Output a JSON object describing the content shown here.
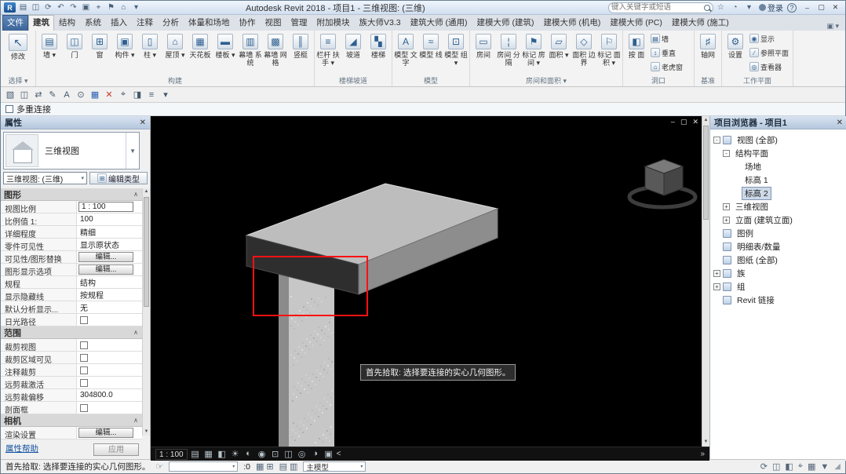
{
  "titlebar": {
    "title": "Autodesk Revit 2018 -  项目1 - 三维视图: (三维)",
    "logo_letter": "R",
    "search": {
      "placeholder": "键入关键字或短语"
    },
    "signin_label": "登录",
    "help_glyph": "?",
    "qat_icons": [
      {
        "name": "open-icon",
        "glyph": "▤"
      },
      {
        "name": "save-icon",
        "glyph": "◫"
      },
      {
        "name": "sync-icon",
        "glyph": "⟳"
      },
      {
        "name": "undo-icon",
        "glyph": "↶"
      },
      {
        "name": "redo-icon",
        "glyph": "↷"
      },
      {
        "name": "print-icon",
        "glyph": "▣"
      },
      {
        "name": "measure-icon",
        "glyph": "⌖"
      },
      {
        "name": "tag-icon",
        "glyph": "⚑"
      },
      {
        "name": "default-3d-view-icon",
        "glyph": "⌂"
      },
      {
        "name": "customize-qat-icon",
        "glyph": "▾"
      }
    ],
    "info_icons": [
      {
        "name": "exchange-apps-icon",
        "glyph": "☆"
      },
      {
        "name": "notification-icon",
        "glyph": "◔"
      },
      {
        "name": "help-menu-icon",
        "glyph": "▾"
      }
    ],
    "window_buttons": [
      {
        "name": "minimize-button",
        "glyph": "–"
      },
      {
        "name": "maximize-button",
        "glyph": "▢"
      },
      {
        "name": "close-button",
        "glyph": "✕"
      }
    ]
  },
  "tabs": {
    "active_index": 1,
    "items": [
      "文件",
      "建筑",
      "结构",
      "系统",
      "插入",
      "注释",
      "分析",
      "体量和场地",
      "协作",
      "视图",
      "管理",
      "附加模块",
      "族大师V3.3",
      "建筑大师 (通用)",
      "建模大师 (建筑)",
      "建模大师 (机电)",
      "建模大师 (PC)",
      "建模大师 (施工)"
    ],
    "ribbon_toggle_glyph": "▣ ▾"
  },
  "ribbon": {
    "panels": [
      {
        "name": "select",
        "label": "选择 ▾",
        "tools": [
          {
            "type": "big",
            "wide": true,
            "name": "modify",
            "label": "修改",
            "glyph": "↖"
          }
        ]
      },
      {
        "name": "build",
        "label": "构建",
        "tools": [
          {
            "type": "big",
            "name": "wall",
            "label": "墙",
            "glyph": "▤",
            "arrow": true
          },
          {
            "type": "big",
            "name": "door",
            "label": "门",
            "glyph": "◫"
          },
          {
            "type": "big",
            "name": "window",
            "label": "窗",
            "glyph": "⊞"
          },
          {
            "type": "big",
            "name": "component",
            "label": "构件",
            "glyph": "▣",
            "arrow": true
          },
          {
            "type": "big",
            "name": "column",
            "label": "柱",
            "glyph": "▯",
            "arrow": true
          },
          {
            "type": "big",
            "name": "roof",
            "label": "屋顶",
            "glyph": "⌂",
            "arrow": true
          },
          {
            "type": "big",
            "name": "ceiling",
            "label": "天花板",
            "glyph": "▦"
          },
          {
            "type": "big",
            "name": "floor",
            "label": "楼板",
            "glyph": "▬",
            "arrow": true
          },
          {
            "type": "big",
            "name": "curtain-system",
            "label": "幕墙 系统",
            "glyph": "▥"
          },
          {
            "type": "big",
            "name": "curtain-grid",
            "label": "幕墙 网格",
            "glyph": "▩"
          },
          {
            "type": "big",
            "name": "mullion",
            "label": "竖梃",
            "glyph": "║"
          }
        ]
      },
      {
        "name": "circulation",
        "label": "楼梯坡道",
        "tools": [
          {
            "type": "big",
            "name": "railing",
            "label": "栏杆 扶手",
            "glyph": "≡",
            "arrow": true
          },
          {
            "type": "big",
            "name": "ramp",
            "label": "坡道",
            "glyph": "◢"
          },
          {
            "type": "big",
            "name": "stair",
            "label": "楼梯",
            "glyph": "▚"
          }
        ]
      },
      {
        "name": "model",
        "label": "模型",
        "tools": [
          {
            "type": "big",
            "name": "model-text",
            "label": "模型 文字",
            "glyph": "A"
          },
          {
            "type": "big",
            "name": "model-line",
            "label": "模型 线",
            "glyph": "≈"
          },
          {
            "type": "big",
            "name": "model-group",
            "label": "模型 组",
            "glyph": "⊡",
            "arrow": true
          }
        ]
      },
      {
        "name": "room-area",
        "label": "房间和面积 ▾",
        "tools": [
          {
            "type": "big",
            "name": "room",
            "label": "房间",
            "glyph": "▭"
          },
          {
            "type": "big",
            "name": "room-separator",
            "label": "房间 分隔",
            "glyph": "¦"
          },
          {
            "type": "big",
            "name": "tag-room",
            "label": "标记 房间",
            "glyph": "⚑",
            "arrow": true
          },
          {
            "type": "big",
            "name": "area",
            "label": "面积",
            "glyph": "▱",
            "arrow": true
          },
          {
            "type": "big",
            "name": "area-boundary",
            "label": "面积 边界",
            "glyph": "◇"
          },
          {
            "type": "big",
            "name": "tag-area",
            "label": "标记 面积",
            "glyph": "⚐",
            "arrow": true
          }
        ]
      },
      {
        "name": "opening",
        "label": "洞口",
        "tools": [
          {
            "type": "big",
            "name": "opening-by-face",
            "label": "按 面",
            "glyph": "◧"
          },
          {
            "type": "stack",
            "items": [
              {
                "name": "wall-opening",
                "label": "墙",
                "glyph": "▤"
              },
              {
                "name": "vertical-opening",
                "label": "垂直",
                "glyph": "↕"
              },
              {
                "name": "dormer-opening",
                "label": "老虎窗",
                "glyph": "⌂"
              }
            ]
          }
        ]
      },
      {
        "name": "datum",
        "label": "基准",
        "tools": [
          {
            "type": "big",
            "name": "grid",
            "label": "轴网",
            "glyph": "♯"
          }
        ]
      },
      {
        "name": "work-plane",
        "label": "工作平面",
        "tools": [
          {
            "type": "big",
            "name": "set-work-plane",
            "label": "设置",
            "glyph": "⚙"
          },
          {
            "type": "stack",
            "items": [
              {
                "name": "show-work-plane",
                "label": "显示",
                "glyph": "◉"
              },
              {
                "name": "ref-plane",
                "label": "参照平面",
                "glyph": "∕"
              },
              {
                "name": "work-plane-viewer",
                "label": "查看器",
                "glyph": "◎"
              }
            ]
          }
        ]
      }
    ]
  },
  "toolbar2": {
    "icons": [
      {
        "name": "sheet-icon",
        "glyph": "▧",
        "color": "#45586b"
      },
      {
        "name": "save-small-icon",
        "glyph": "◫",
        "color": "#45586b"
      },
      {
        "name": "swap-icon",
        "glyph": "⇄",
        "color": "#45586b"
      },
      {
        "name": "pencil-icon",
        "glyph": "✎",
        "color": "#45586b"
      },
      {
        "name": "text-tool-icon",
        "glyph": "A",
        "color": "#45586b"
      },
      {
        "name": "circle-tool-icon",
        "glyph": "⊙",
        "color": "#45586b"
      },
      {
        "name": "grid-tool-icon",
        "glyph": "▦",
        "color": "#2a5db0"
      },
      {
        "name": "delete-tool-icon",
        "glyph": "✕",
        "color": "#c0392b"
      },
      {
        "name": "measure-tool-icon",
        "glyph": "⌖",
        "color": "#45586b"
      },
      {
        "name": "section-tool-icon",
        "glyph": "◨",
        "color": "#45586b"
      },
      {
        "name": "list-tool-icon",
        "glyph": "≡",
        "color": "#45586b"
      },
      {
        "name": "more-tools-icon",
        "glyph": "▾",
        "color": "#45586b"
      }
    ]
  },
  "options_bar": {
    "label": "多重连接",
    "checked": false
  },
  "props": {
    "header": "属性",
    "close_glyph": "✕",
    "type_selector": {
      "label": "三维视图",
      "arrow": "▼"
    },
    "view_combo": {
      "value": "三维视图: (三维)",
      "arrow": "▾"
    },
    "edit_type_label": "编辑类型",
    "rows": [
      {
        "t": "section",
        "label": "图形"
      },
      {
        "t": "value",
        "label": "视图比例",
        "value": "1 : 100",
        "boxed": true
      },
      {
        "t": "value",
        "label": "比例值  1:",
        "value": "100"
      },
      {
        "t": "value",
        "label": "详细程度",
        "value": "精细"
      },
      {
        "t": "value",
        "label": "零件可见性",
        "value": "显示原状态"
      },
      {
        "t": "button",
        "label": "可见性/图形替换",
        "value": "编辑..."
      },
      {
        "t": "button",
        "label": "图形显示选项",
        "value": "编辑..."
      },
      {
        "t": "value",
        "label": "规程",
        "value": "结构"
      },
      {
        "t": "value",
        "label": "显示隐藏线",
        "value": "按规程"
      },
      {
        "t": "value",
        "label": "默认分析显示...",
        "value": "无"
      },
      {
        "t": "check",
        "label": "日光路径",
        "checked": false
      },
      {
        "t": "section",
        "label": "范围"
      },
      {
        "t": "check",
        "label": "裁剪视图",
        "checked": false
      },
      {
        "t": "check",
        "label": "裁剪区域可见",
        "checked": false
      },
      {
        "t": "check",
        "label": "注释裁剪",
        "checked": false
      },
      {
        "t": "check",
        "label": "远剪裁激活",
        "checked": false
      },
      {
        "t": "value",
        "label": "远剪裁偏移",
        "value": "304800.0"
      },
      {
        "t": "check",
        "label": "剖面框",
        "checked": false
      },
      {
        "t": "section",
        "label": "相机"
      },
      {
        "t": "button",
        "label": "渲染设置",
        "value": "编辑..."
      }
    ],
    "help_label": "属性帮助",
    "apply_label": "应用"
  },
  "viewport": {
    "tooltip": "首先拾取: 选择要连接的实心几何图形。",
    "scale_label": "1 : 100",
    "window_buttons": [
      {
        "name": "view-minimize-button",
        "glyph": "–"
      },
      {
        "name": "view-restore-button",
        "glyph": "▢"
      },
      {
        "name": "view-close-button",
        "glyph": "✕"
      }
    ],
    "view_controls": [
      {
        "name": "sheet-size-icon",
        "glyph": "▤"
      },
      {
        "name": "detail-level-icon",
        "glyph": "▦"
      },
      {
        "name": "visual-style-icon",
        "glyph": "◧"
      },
      {
        "name": "sun-path-icon",
        "glyph": "☀"
      },
      {
        "name": "shadows-icon",
        "glyph": "◐"
      },
      {
        "name": "render-icon",
        "glyph": "◉"
      },
      {
        "name": "crop-view-icon",
        "glyph": "⊡"
      },
      {
        "name": "show-crop-icon",
        "glyph": "◫"
      },
      {
        "name": "temporary-hide-icon",
        "glyph": "◎"
      },
      {
        "name": "reveal-hidden-icon",
        "glyph": "◑"
      },
      {
        "name": "analytical-model-icon",
        "glyph": "▣"
      }
    ],
    "scroll_left_glyph": "<",
    "scroll_right_glyph": "»"
  },
  "browser": {
    "header": "项目浏览器 - 项目1",
    "close_glyph": "✕",
    "items": [
      {
        "label": "视图 (全部)",
        "level": 0,
        "exp": "minus",
        "icon": "views-icon",
        "selected": false
      },
      {
        "label": "结构平面",
        "level": 1,
        "exp": "minus",
        "icon": null,
        "selected": false
      },
      {
        "label": "场地",
        "level": 2,
        "exp": null,
        "icon": null,
        "selected": false
      },
      {
        "label": "标高 1",
        "level": 2,
        "exp": null,
        "icon": null,
        "selected": false
      },
      {
        "label": "标高 2",
        "level": 2,
        "exp": null,
        "icon": null,
        "selected": true
      },
      {
        "label": "三维视图",
        "level": 1,
        "exp": "plus",
        "icon": null,
        "selected": false
      },
      {
        "label": "立面 (建筑立面)",
        "level": 1,
        "exp": "plus",
        "icon": null,
        "selected": false
      },
      {
        "label": "图例",
        "level": 0,
        "exp": null,
        "icon": "legends-icon",
        "selected": false
      },
      {
        "label": "明细表/数量",
        "level": 0,
        "exp": null,
        "icon": "schedules-icon",
        "selected": false
      },
      {
        "label": "图纸 (全部)",
        "level": 0,
        "exp": null,
        "icon": "sheets-icon",
        "selected": false
      },
      {
        "label": "族",
        "level": 0,
        "exp": "plus",
        "icon": "families-icon",
        "selected": false
      },
      {
        "label": "组",
        "level": 0,
        "exp": "plus",
        "icon": "groups-icon",
        "selected": false
      },
      {
        "label": "Revit 链接",
        "level": 0,
        "exp": null,
        "icon": "revit-links-icon",
        "selected": false
      }
    ]
  },
  "statusbar": {
    "message": "首先拾取: 选择要连接的实心几何图形。",
    "pan_glyph": "☞",
    "requests_count": ":0",
    "mid_icons": [
      {
        "name": "selection-grid-icon",
        "glyph": "▦"
      },
      {
        "name": "selection-add-icon",
        "glyph": "⊞"
      }
    ],
    "doc_icons": [
      {
        "name": "doc-icon",
        "glyph": "▤"
      },
      {
        "name": "doc-icon-2",
        "glyph": "▥"
      }
    ],
    "model_label": "主模型",
    "right_icons": [
      {
        "name": "background-processes-icon",
        "glyph": "⟳"
      },
      {
        "name": "worksets-toggle-icon",
        "glyph": "◫"
      },
      {
        "name": "design-options-toggle-icon",
        "glyph": "◧"
      },
      {
        "name": "select-links-toggle-icon",
        "glyph": "⌖"
      },
      {
        "name": "select-by-face-toggle-icon",
        "glyph": "▦"
      },
      {
        "name": "filter-icon",
        "glyph": "▼"
      }
    ],
    "grip_glyph": "◢"
  }
}
